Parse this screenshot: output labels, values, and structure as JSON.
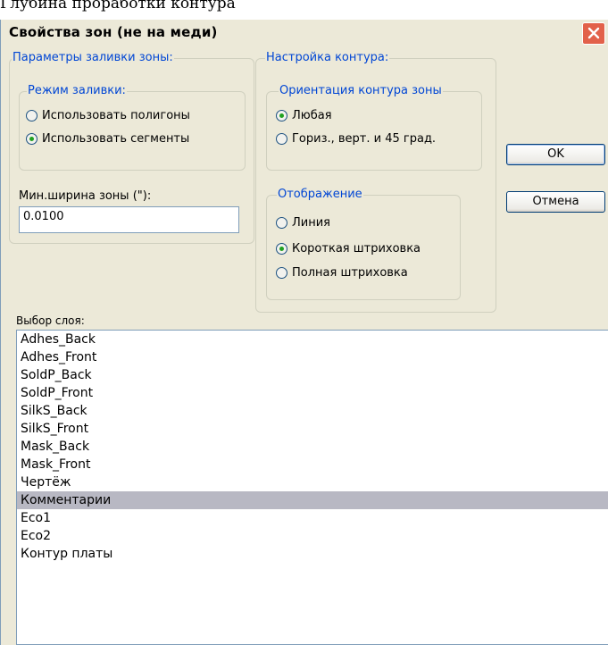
{
  "top_fragment": "Глубина проработки контура",
  "dialog": {
    "title": "Свойства зон (не на меди)",
    "fill_params": {
      "legend": "Параметры заливки зоны:",
      "fill_mode": {
        "legend": "Режим заливки:",
        "options": [
          {
            "label": "Использовать полигоны",
            "checked": false
          },
          {
            "label": "Использовать сегменты",
            "checked": true
          }
        ]
      },
      "min_width": {
        "label": "Мин.ширина зоны (\"):",
        "value": "0.0100"
      }
    },
    "outline": {
      "legend": "Настройка контура:",
      "orientation": {
        "legend": "Ориентация контура зоны",
        "options": [
          {
            "label": "Любая",
            "checked": true
          },
          {
            "label": "Гориз., верт. и 45 град.",
            "checked": false
          }
        ]
      },
      "display": {
        "legend": "Отображение",
        "options": [
          {
            "label": "Линия",
            "checked": false
          },
          {
            "label": "Короткая штриховка",
            "checked": true
          },
          {
            "label": "Полная штриховка",
            "checked": false
          }
        ]
      }
    },
    "buttons": {
      "ok": "OK",
      "cancel": "Отмена"
    },
    "layers": {
      "label": "Выбор слоя:",
      "items": [
        "Adhes_Back",
        "Adhes_Front",
        "SoldP_Back",
        "SoldP_Front",
        "SilkS_Back",
        "SilkS_Front",
        "Mask_Back",
        "Mask_Front",
        "Чертёж",
        "Комментарии",
        "Eco1",
        "Eco2",
        "Контур платы"
      ],
      "selected": "Комментарии"
    }
  },
  "colors": {
    "accent_blue": "#0046d5",
    "radio_green": "#21a121",
    "close_red": "#e2614a",
    "selection": "#b8b8c3"
  }
}
